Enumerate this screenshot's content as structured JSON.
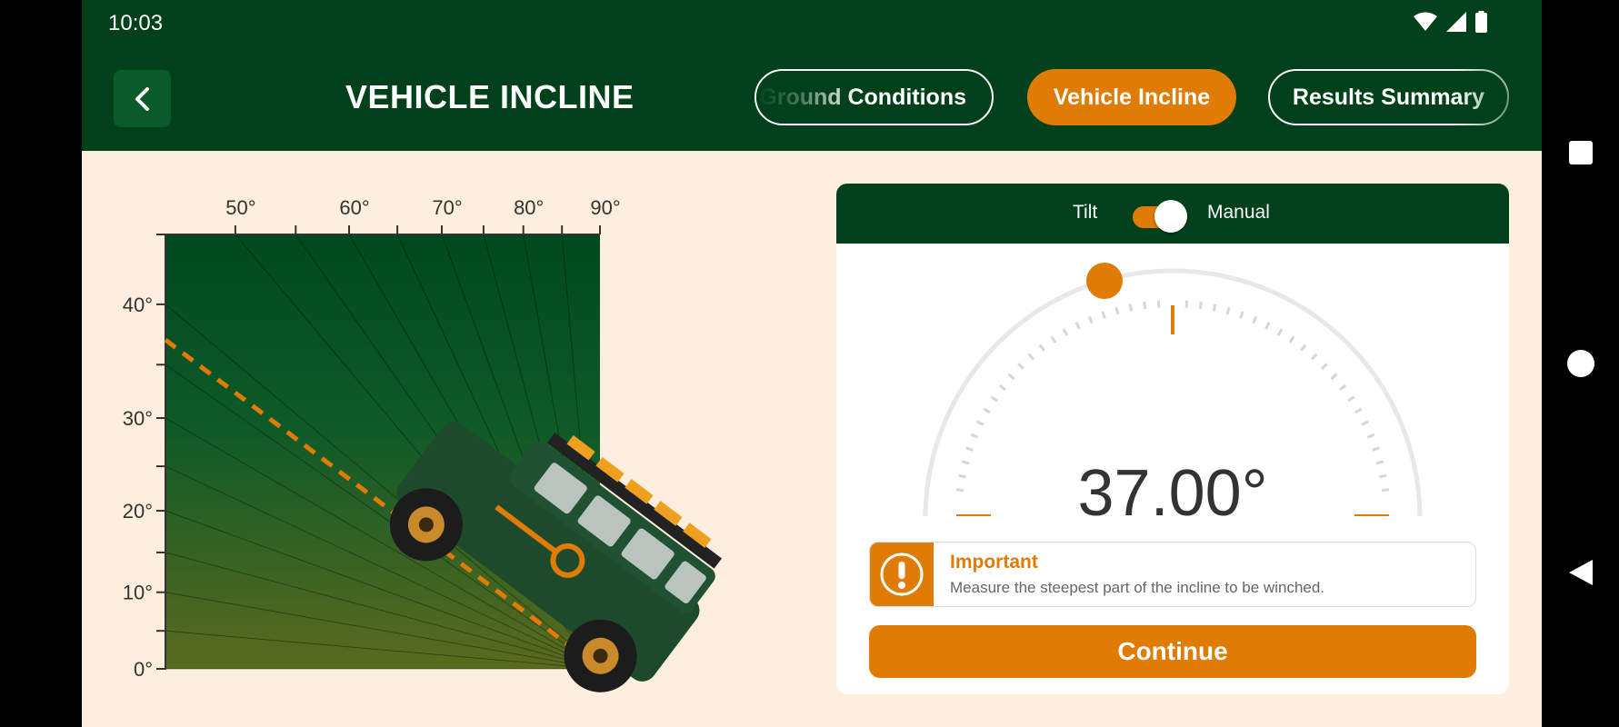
{
  "status": {
    "time": "10:03",
    "icons": [
      "wifi-icon",
      "signal-icon",
      "battery-icon"
    ]
  },
  "header": {
    "back_icon": "chevron-left-icon",
    "title": "VEHICLE INCLINE",
    "tabs": [
      {
        "label": "Ground Conditions",
        "state": "inactive"
      },
      {
        "label": "Vehicle Incline",
        "state": "active"
      },
      {
        "label": "Results Summary",
        "state": "inactive"
      }
    ]
  },
  "chart_data": {
    "type": "incline-diagram",
    "top_ticks": [
      "50°",
      "60°",
      "70°",
      "80°",
      "90°"
    ],
    "left_ticks": [
      "40°",
      "30°",
      "20°",
      "10°",
      "0°"
    ],
    "incline_angle_deg": 37,
    "colors": {
      "ground": "#0a5a2a",
      "slope_line": "#e07b06"
    }
  },
  "panel": {
    "toggle": {
      "left_label": "Tilt",
      "right_label": "Manual",
      "on": true
    },
    "gauge": {
      "value_text": "37.00°",
      "value_deg": 37
    },
    "notice": {
      "icon": "exclamation-icon",
      "title": "Important",
      "text": "Measure the steepest part of the incline to be winched."
    },
    "continue_label": "Continue"
  },
  "colors": {
    "brand_green": "#00401b",
    "accent_orange": "#e07b06",
    "background": "#fdeede"
  },
  "nav": {
    "icons": [
      "recents-square-icon",
      "home-circle-icon",
      "back-triangle-icon"
    ]
  }
}
